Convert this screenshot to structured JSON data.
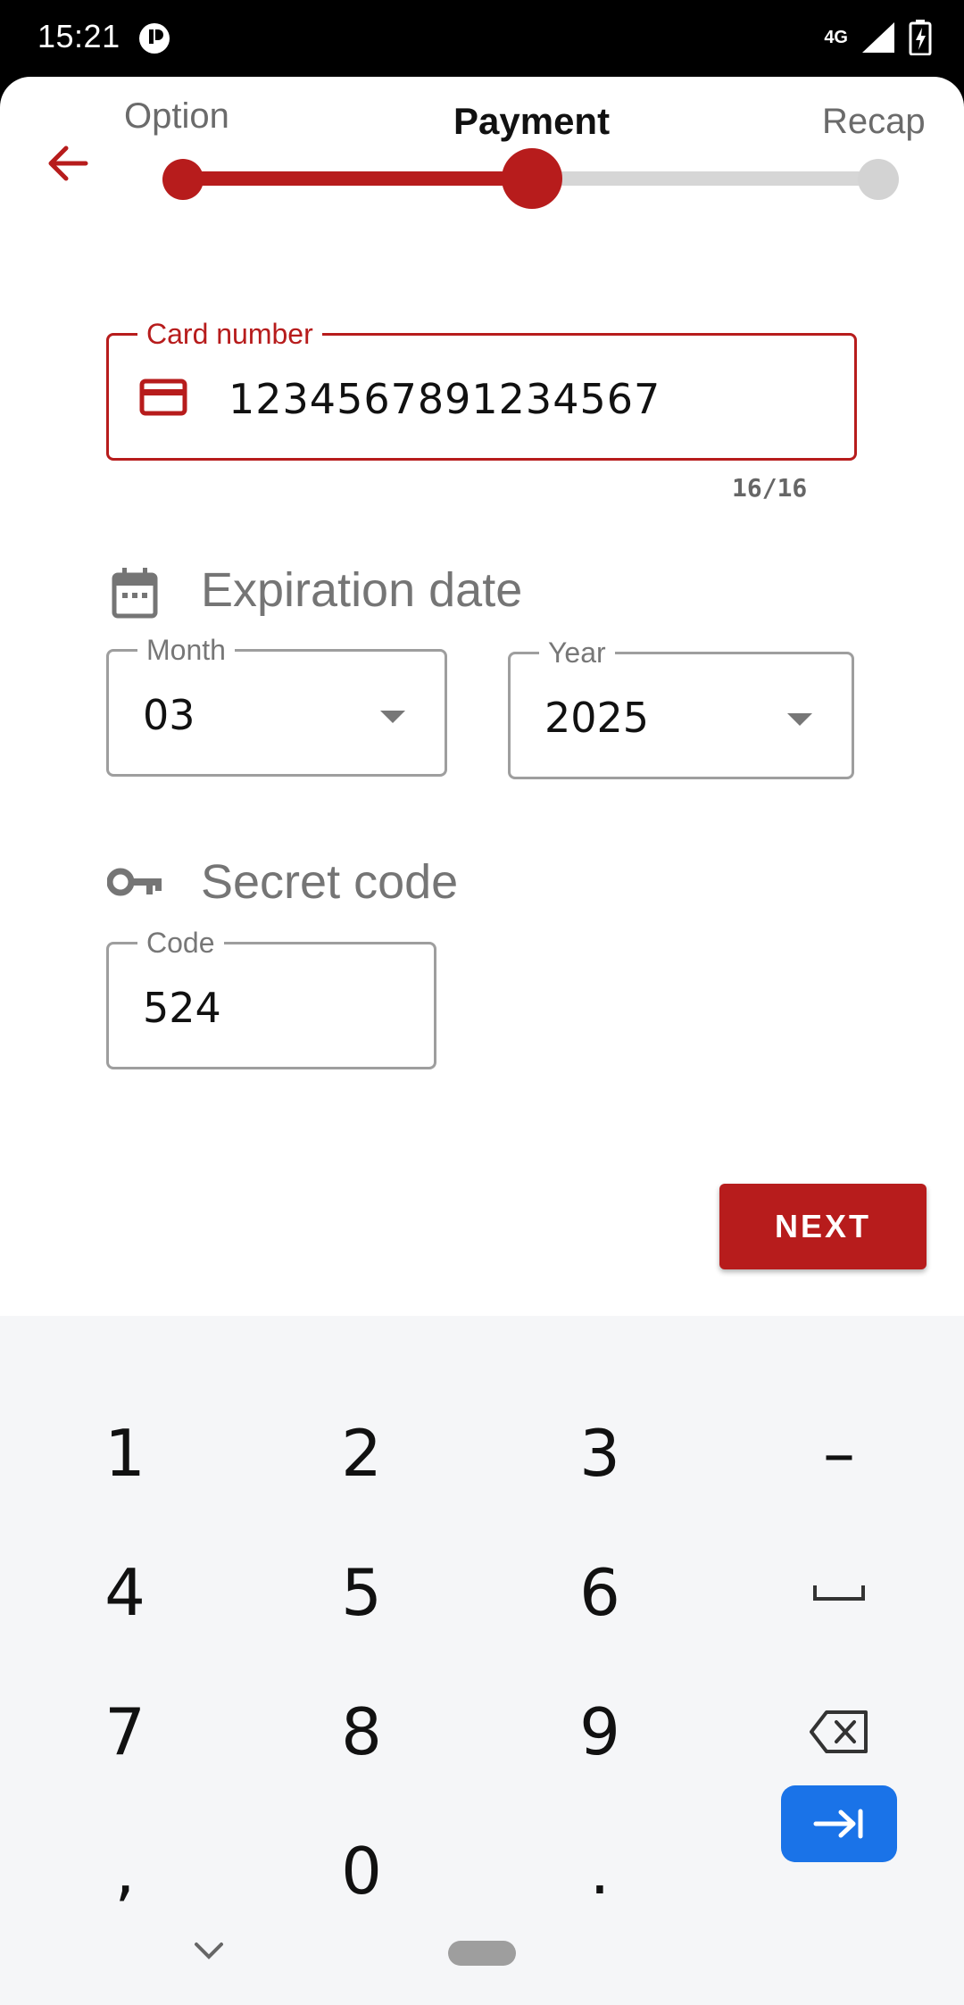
{
  "status_bar": {
    "time": "15:21",
    "network": "4G"
  },
  "stepper": {
    "steps": [
      {
        "label": "Option"
      },
      {
        "label": "Payment"
      },
      {
        "label": "Recap"
      }
    ],
    "current_step_index": 1,
    "progress_fraction": 0.5,
    "accent_color": "#b71c1c",
    "inactive_color": "#d6d6d6"
  },
  "card": {
    "label": "Card number",
    "value": "1234567891234567",
    "counter": "16/16",
    "icon": "credit-card-icon"
  },
  "expiration": {
    "title": "Expiration date",
    "icon": "calendar-icon",
    "month": {
      "label": "Month",
      "value": "03"
    },
    "year": {
      "label": "Year",
      "value": "2025"
    }
  },
  "secret": {
    "title": "Secret code",
    "icon": "key-icon",
    "code": {
      "label": "Code",
      "value": "524"
    }
  },
  "next_button": {
    "label": "NEXT"
  },
  "keyboard": {
    "rows": [
      [
        "1",
        "2",
        "3",
        "–"
      ],
      [
        "4",
        "5",
        "6",
        "space-icon"
      ],
      [
        "7",
        "8",
        "9",
        "backspace-icon"
      ],
      [
        ",",
        "0",
        ".",
        "tab-icon"
      ]
    ],
    "tab_key_color": "#1a73e8"
  }
}
